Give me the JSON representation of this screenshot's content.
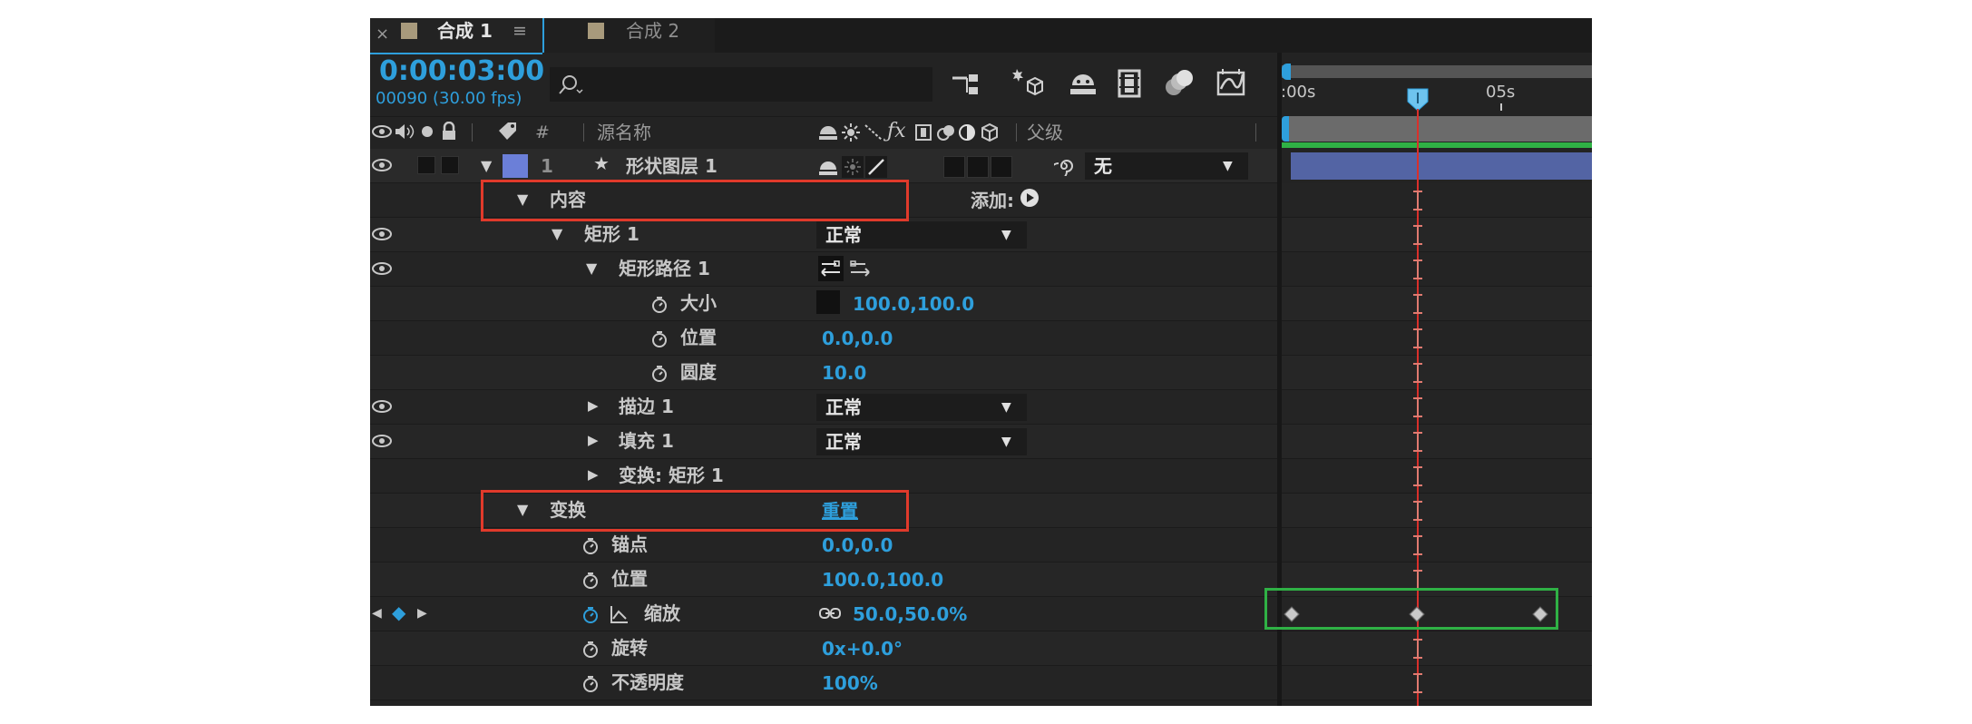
{
  "tabs": [
    {
      "label": "合成 1",
      "active": true
    },
    {
      "label": "合成 2",
      "active": false
    }
  ],
  "tab_close_glyph": "×",
  "tab_menu_glyph": "≡",
  "timecode": "0:00:03:00",
  "frame_info": "00090 (30.00 fps)",
  "search": {
    "placeholder": "",
    "icon": "search-icon"
  },
  "ruler": {
    "labels": [
      ":00s",
      "05s"
    ]
  },
  "columns": {
    "hash": "#",
    "source_name": "源名称",
    "parent": "父级"
  },
  "layer": {
    "index": "1",
    "name": "形状图层 1",
    "parent_value": "无"
  },
  "rows": {
    "contents": {
      "label": "内容",
      "add_label": "添加:"
    },
    "rect1": {
      "label": "矩形 1",
      "blend": "正常"
    },
    "rect_path": {
      "label": "矩形路径 1"
    },
    "size": {
      "label": "大小",
      "value": "100.0,100.0"
    },
    "position_path": {
      "label": "位置",
      "value": "0.0,0.0"
    },
    "roundness": {
      "label": "圆度",
      "value": "10.0"
    },
    "stroke": {
      "label": "描边 1",
      "blend": "正常"
    },
    "fill": {
      "label": "填充 1",
      "blend": "正常"
    },
    "transform_rect": {
      "label": "变换: 矩形 1"
    },
    "transform": {
      "label": "变换",
      "reset": "重置"
    },
    "anchor": {
      "label": "锚点",
      "value": "0.0,0.0"
    },
    "position": {
      "label": "位置",
      "value": "100.0,100.0"
    },
    "scale": {
      "label": "缩放",
      "value": "50.0,50.0%"
    },
    "rotation": {
      "label": "旋转",
      "value": "0x+0.0°"
    },
    "opacity": {
      "label": "不透明度",
      "value": "100%"
    }
  },
  "colors": {
    "timecode": "#2e9fdc",
    "label_color": "#6b7fd8",
    "highlight_red": "#e03a2b",
    "highlight_green": "#2fb145",
    "layer_bar": "#5364a4",
    "playhead": "#d9302b"
  }
}
